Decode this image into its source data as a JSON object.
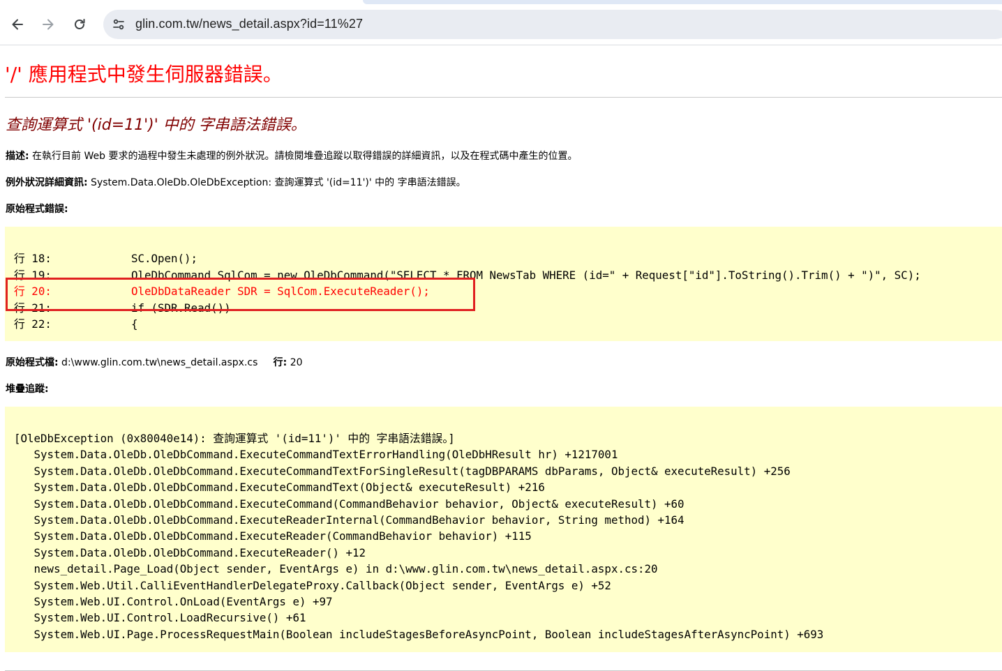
{
  "browser": {
    "url": "glin.com.tw/news_detail.aspx?id=11%27",
    "back_icon": "arrow-left-icon",
    "forward_icon": "arrow-right-icon",
    "reload_icon": "reload-icon",
    "site_info_icon": "tune-icon"
  },
  "page": {
    "title": "'/' 應用程式中發生伺服器錯誤。",
    "subtitle": "查詢運算式 '(id=11')' 中的 字串語法錯誤。",
    "description_label": "描述:",
    "description_text": " 在執行目前 Web 要求的過程中發生未處理的例外狀況。請檢閱堆疊追蹤以取得錯誤的詳細資訊，以及在程式碼中產生的位置。",
    "exception_label": "例外狀況詳細資訊:",
    "exception_text": " System.Data.OleDb.OleDbException: 查詢運算式 '(id=11')' 中的 字串語法錯誤。",
    "source_error_label": "原始程式錯誤:",
    "source_lines": [
      "行 18:            SC.Open();",
      "行 19:            OleDbCommand SqlCom = new OleDbCommand(\"SELECT * FROM NewsTab WHERE (id=\" + Request[\"id\"].ToString().Trim() + \")\", SC);",
      "行 20:            OleDbDataReader SDR = SqlCom.ExecuteReader();",
      "行 21:            if (SDR.Read())",
      "行 22:            {"
    ],
    "highlighted_line_index": 2,
    "source_file_label": "原始程式檔:",
    "source_file_path": " d:\\www.glin.com.tw\\news_detail.aspx.cs",
    "source_line_label": "行:",
    "source_line_number": " 20",
    "stack_trace_label": "堆疊追蹤:",
    "stack_lines": [
      "[OleDbException (0x80040e14): 查詢運算式 '(id=11')' 中的 字串語法錯誤。]",
      "   System.Data.OleDb.OleDbCommand.ExecuteCommandTextErrorHandling(OleDbHResult hr) +1217001",
      "   System.Data.OleDb.OleDbCommand.ExecuteCommandTextForSingleResult(tagDBPARAMS dbParams, Object& executeResult) +256",
      "   System.Data.OleDb.OleDbCommand.ExecuteCommandText(Object& executeResult) +216",
      "   System.Data.OleDb.OleDbCommand.ExecuteCommand(CommandBehavior behavior, Object& executeResult) +60",
      "   System.Data.OleDb.OleDbCommand.ExecuteReaderInternal(CommandBehavior behavior, String method) +164",
      "   System.Data.OleDb.OleDbCommand.ExecuteReader(CommandBehavior behavior) +115",
      "   System.Data.OleDb.OleDbCommand.ExecuteReader() +12",
      "   news_detail.Page_Load(Object sender, EventArgs e) in d:\\www.glin.com.tw\\news_detail.aspx.cs:20",
      "   System.Web.Util.CalliEventHandlerDelegateProxy.Callback(Object sender, EventArgs e) +52",
      "   System.Web.UI.Control.OnLoad(EventArgs e) +97",
      "   System.Web.UI.Control.LoadRecursive() +61",
      "   System.Web.UI.Page.ProcessRequestMain(Boolean includeStagesBeforeAsyncPoint, Boolean includeStagesAfterAsyncPoint) +693"
    ]
  },
  "colors": {
    "title": "#ff0000",
    "subtitle": "#800000",
    "code_background": "#ffffcc",
    "highlight_box": "#e02020"
  }
}
